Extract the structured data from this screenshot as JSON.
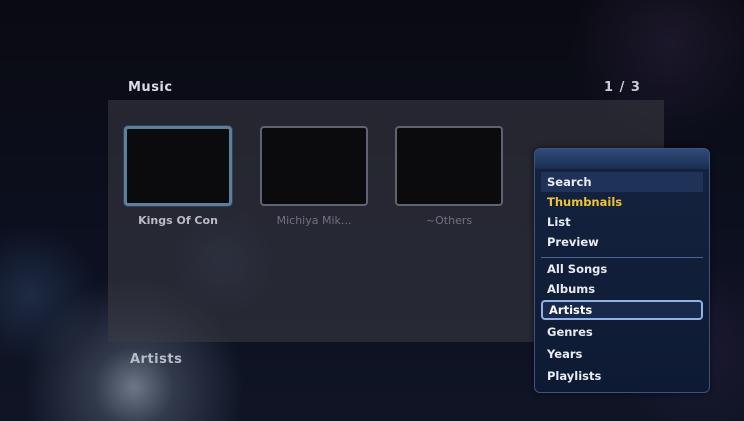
{
  "header": {
    "title": "Music",
    "page_counter": "1 / 3"
  },
  "thumbnails": [
    {
      "label": "Kings Of Con",
      "selected": true
    },
    {
      "label": "Michiya Mik...",
      "selected": false
    },
    {
      "label": "~Others",
      "selected": false
    }
  ],
  "footer": {
    "category": "Artists"
  },
  "menu": {
    "items": [
      {
        "label": "Search"
      },
      {
        "label": "Thumbnails",
        "highlight": true
      },
      {
        "label": "List"
      },
      {
        "label": "Preview"
      },
      {
        "label": "All Songs"
      },
      {
        "label": "Albums"
      },
      {
        "label": "Artists",
        "selected": true
      },
      {
        "label": "Genres"
      },
      {
        "label": "Years"
      },
      {
        "label": "Playlists"
      }
    ]
  },
  "colors": {
    "highlight": "#f0c23a",
    "selection_border": "#8fb3e3",
    "menu_bg": "#14233f"
  }
}
